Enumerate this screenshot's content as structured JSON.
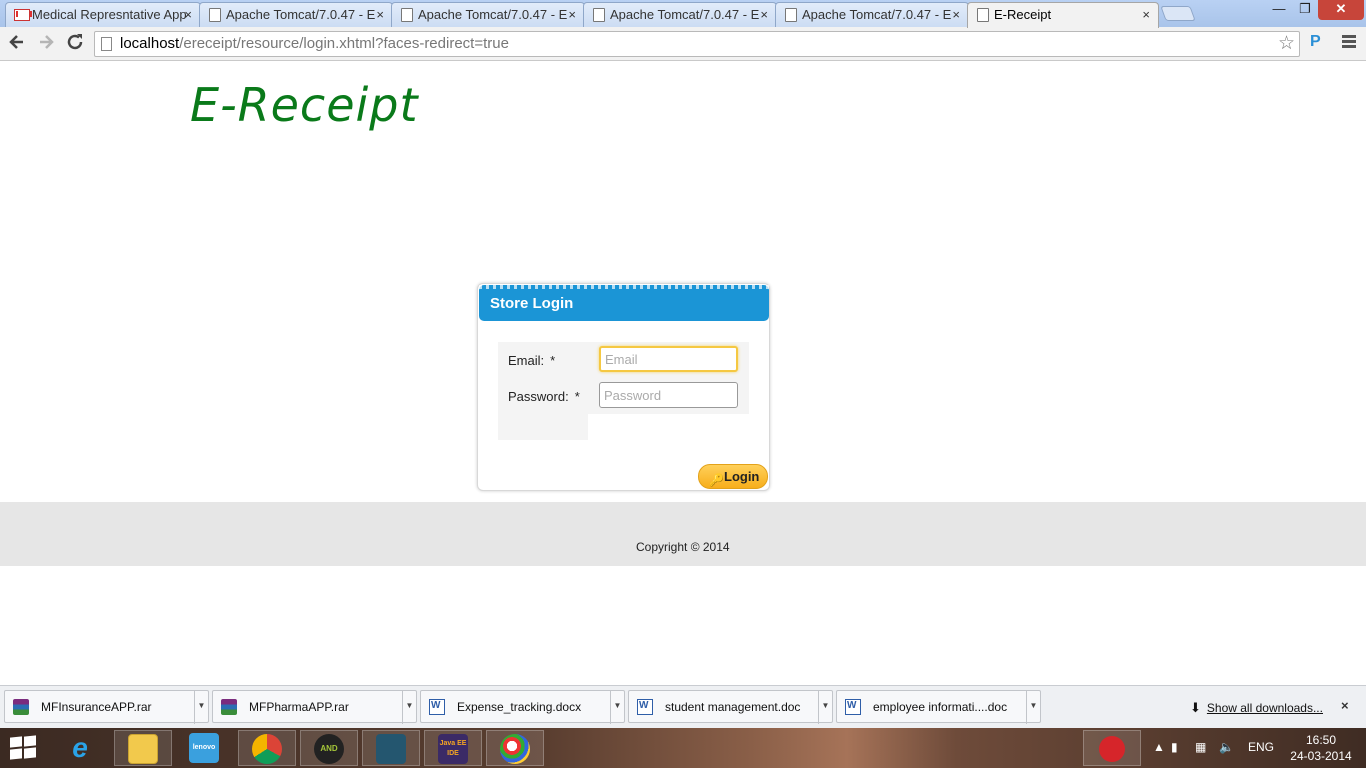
{
  "browser": {
    "tabs": [
      {
        "title": "Medical Represntative App",
        "icon": "gmail-icon",
        "active": false
      },
      {
        "title": "Apache Tomcat/7.0.47 - E",
        "icon": "page-icon",
        "active": false
      },
      {
        "title": "Apache Tomcat/7.0.47 - E",
        "icon": "page-icon",
        "active": false
      },
      {
        "title": "Apache Tomcat/7.0.47 - E",
        "icon": "page-icon",
        "active": false
      },
      {
        "title": "Apache Tomcat/7.0.47 - E",
        "icon": "page-icon",
        "active": false
      },
      {
        "title": "E-Receipt",
        "icon": "page-icon",
        "active": true
      }
    ],
    "close_glyph": "×",
    "window_controls": {
      "minimize": "—",
      "maximize": "❐",
      "close": "✕"
    },
    "url_host": "localhost",
    "url_path": "/ereceipt/resource/login.xhtml?faces-redirect=true",
    "extension_label": "P"
  },
  "page": {
    "logo_text": "E-Receipt",
    "logo_color": "#0a7a1a",
    "login": {
      "header": "Store Login",
      "email_label": "Email:",
      "password_label": "Password:",
      "required_marker": "*",
      "email_placeholder": "Email",
      "password_placeholder": "Password",
      "login_button": "Login"
    },
    "footer_text": "Copyright © 2014",
    "accent_color": "#1b95d6"
  },
  "downloads": {
    "items": [
      {
        "name": "MFInsuranceAPP.rar",
        "type": "rar"
      },
      {
        "name": "MFPharmaAPP.rar",
        "type": "rar"
      },
      {
        "name": "Expense_tracking.docx",
        "type": "doc"
      },
      {
        "name": "student management.doc",
        "type": "doc"
      },
      {
        "name": "employee  informati....doc",
        "type": "doc"
      }
    ],
    "show_all": "Show all downloads...",
    "close_glyph": "×"
  },
  "taskbar": {
    "apps": [
      {
        "name": "internet-explorer",
        "label": "e"
      },
      {
        "name": "file-explorer",
        "label": ""
      },
      {
        "name": "lenovo",
        "label": "lenovo"
      },
      {
        "name": "chrome",
        "label": ""
      },
      {
        "name": "android",
        "label": "AND"
      },
      {
        "name": "mysql",
        "label": ""
      },
      {
        "name": "java-ee-ide",
        "label": "Java EE IDE"
      },
      {
        "name": "paint",
        "label": ""
      }
    ],
    "language": "ENG",
    "time": "16:50",
    "date": "24-03-2014"
  }
}
